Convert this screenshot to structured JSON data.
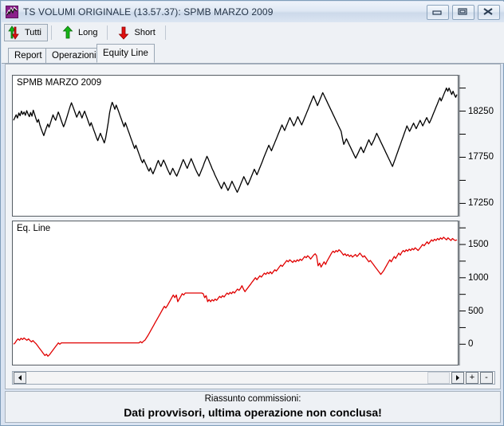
{
  "window": {
    "title": "TS VOLUMI ORIGINALE (13.57.37): SPMB MARZO 2009",
    "icon": "chart-line-icon",
    "controls": {
      "minimize": "minimize-icon",
      "maximize": "restore-icon",
      "close": "close-icon"
    }
  },
  "toolbar": {
    "buttons": [
      {
        "label": "Tutti",
        "icon": "up-down-arrows-icon",
        "active": true
      },
      {
        "label": "Long",
        "icon": "green-up-arrow-icon",
        "active": false
      },
      {
        "label": "Short",
        "icon": "red-down-arrow-icon",
        "active": false
      }
    ]
  },
  "tabs": {
    "items": [
      {
        "label": "Report",
        "selected": false
      },
      {
        "label": "Operazioni",
        "selected": false
      },
      {
        "label": "Equity Line",
        "selected": true
      }
    ]
  },
  "scrollbar": {
    "left_arrow": "left-arrow-icon",
    "right_arrow": "right-arrow-icon",
    "zoom_in": "+",
    "zoom_out": "-"
  },
  "status": {
    "line1": "Riassunto commissioni:",
    "line2": "Dati provvisori, ultima operazione non conclusa!"
  },
  "colors": {
    "price_line": "#000000",
    "equity_line": "#e00000",
    "chart_bg": "#ffffff",
    "chart_border": "#555c63",
    "window_bg": "#d9e3f1",
    "panel_bg": "#f2f4f7"
  },
  "chart_data": [
    {
      "type": "line",
      "title": "SPMB MARZO 2009",
      "name": "price-chart",
      "xlabel": "",
      "ylabel": "",
      "ylim": [
        17150,
        18600
      ],
      "yticks": [
        17250,
        17500,
        17750,
        18000,
        18250,
        18500
      ],
      "ytick_labels": [
        "17250",
        "",
        "17750",
        "",
        "18250",
        ""
      ],
      "grid": false,
      "legend": "none",
      "series": [
        {
          "name": "SPMB MARZO 2009",
          "color": "#000000",
          "values": [
            18150,
            18180,
            18210,
            18175,
            18230,
            18200,
            18250,
            18215,
            18240,
            18205,
            18255,
            18220,
            18190,
            18235,
            18195,
            18260,
            18215,
            18170,
            18130,
            18160,
            18100,
            18060,
            18020,
            17985,
            18030,
            18070,
            18110,
            18075,
            18120,
            18165,
            18210,
            18175,
            18150,
            18195,
            18240,
            18205,
            18160,
            18120,
            18080,
            18115,
            18160,
            18205,
            18255,
            18300,
            18340,
            18305,
            18265,
            18225,
            18185,
            18215,
            18250,
            18215,
            18175,
            18215,
            18250,
            18210,
            18170,
            18130,
            18090,
            18125,
            18085,
            18045,
            18005,
            17965,
            17930,
            17970,
            18010,
            17975,
            17940,
            17905,
            17960,
            18040,
            18130,
            18230,
            18300,
            18345,
            18310,
            18270,
            18315,
            18280,
            18240,
            18200,
            18160,
            18120,
            18080,
            18125,
            18085,
            18045,
            18005,
            17965,
            17925,
            17885,
            17845,
            17880,
            17840,
            17800,
            17760,
            17720,
            17690,
            17725,
            17690,
            17660,
            17625,
            17600,
            17635,
            17600,
            17570,
            17605,
            17640,
            17680,
            17715,
            17680,
            17650,
            17685,
            17720,
            17690,
            17655,
            17620,
            17590,
            17560,
            17595,
            17630,
            17600,
            17570,
            17545,
            17580,
            17615,
            17650,
            17690,
            17725,
            17695,
            17660,
            17630,
            17665,
            17700,
            17735,
            17700,
            17665,
            17630,
            17600,
            17570,
            17545,
            17580,
            17615,
            17650,
            17690,
            17725,
            17760,
            17730,
            17695,
            17660,
            17625,
            17595,
            17560,
            17530,
            17500,
            17470,
            17440,
            17410,
            17445,
            17480,
            17450,
            17420,
            17390,
            17420,
            17455,
            17490,
            17460,
            17430,
            17400,
            17370,
            17400,
            17435,
            17470,
            17505,
            17540,
            17510,
            17480,
            17450,
            17480,
            17515,
            17550,
            17585,
            17620,
            17590,
            17560,
            17595,
            17630,
            17665,
            17700,
            17740,
            17775,
            17810,
            17845,
            17880,
            17850,
            17820,
            17855,
            17890,
            17925,
            17960,
            17995,
            18030,
            18065,
            18100,
            18070,
            18040,
            18075,
            18110,
            18145,
            18180,
            18150,
            18120,
            18090,
            18120,
            18155,
            18190,
            18160,
            18130,
            18100,
            18135,
            18170,
            18205,
            18240,
            18275,
            18310,
            18345,
            18380,
            18415,
            18380,
            18345,
            18310,
            18345,
            18380,
            18415,
            18450,
            18420,
            18390,
            18360,
            18330,
            18300,
            18270,
            18240,
            18210,
            18180,
            18150,
            18120,
            18090,
            18060,
            18030,
            17950,
            17890,
            17920,
            17950,
            17920,
            17890,
            17860,
            17830,
            17800,
            17770,
            17740,
            17770,
            17800,
            17830,
            17860,
            17830,
            17800,
            17835,
            17870,
            17905,
            17940,
            17910,
            17880,
            17910,
            17940,
            17975,
            18010,
            17980,
            17950,
            17920,
            17890,
            17860,
            17830,
            17800,
            17770,
            17740,
            17710,
            17680,
            17650,
            17690,
            17730,
            17770,
            17810,
            17850,
            17890,
            17930,
            17970,
            18010,
            18050,
            18090,
            18060,
            18030,
            18060,
            18090,
            18120,
            18090,
            18060,
            18090,
            18120,
            18150,
            18120,
            18090,
            18120,
            18150,
            18180,
            18150,
            18120,
            18150,
            18185,
            18220,
            18255,
            18290,
            18325,
            18360,
            18395,
            18360,
            18395,
            18430,
            18465,
            18500,
            18465,
            18500,
            18465,
            18430,
            18465,
            18430,
            18400,
            18430
          ]
        }
      ]
    },
    {
      "type": "line",
      "title": "Eq. Line",
      "name": "equity-chart",
      "xlabel": "",
      "ylabel": "",
      "ylim": [
        -260,
        1800
      ],
      "yticks": [
        0,
        250,
        500,
        750,
        1000,
        1250,
        1500,
        1750
      ],
      "ytick_labels": [
        "0",
        "",
        "500",
        "",
        "1000",
        "",
        "1500",
        ""
      ],
      "grid": false,
      "legend": "none",
      "series": [
        {
          "name": "Eq. Line",
          "color": "#e00000",
          "values": [
            0,
            20,
            55,
            80,
            60,
            90,
            70,
            95,
            75,
            60,
            80,
            55,
            35,
            55,
            30,
            10,
            -20,
            -50,
            -80,
            -110,
            -140,
            -170,
            -150,
            -180,
            -160,
            -130,
            -100,
            -70,
            -40,
            -10,
            20,
            0,
            20,
            20,
            20,
            20,
            20,
            20,
            20,
            20,
            20,
            20,
            20,
            20,
            20,
            20,
            20,
            20,
            20,
            20,
            20,
            20,
            20,
            20,
            20,
            20,
            20,
            20,
            20,
            20,
            20,
            20,
            20,
            20,
            20,
            20,
            20,
            20,
            20,
            20,
            20,
            20,
            20,
            20,
            20,
            20,
            20,
            20,
            20,
            20,
            20,
            20,
            20,
            20,
            20,
            40,
            20,
            45,
            60,
            95,
            130,
            170,
            210,
            250,
            290,
            330,
            370,
            410,
            450,
            490,
            530,
            570,
            545,
            580,
            620,
            660,
            700,
            740,
            700,
            740,
            640,
            680,
            720,
            760,
            740,
            770,
            770,
            770,
            770,
            770,
            770,
            770,
            770,
            770,
            770,
            770,
            770,
            760,
            700,
            730,
            640,
            670,
            640,
            670,
            650,
            680,
            660,
            690,
            720,
            700,
            730,
            710,
            740,
            770,
            750,
            780,
            760,
            790,
            770,
            800,
            830,
            810,
            840,
            880,
            830,
            790,
            820,
            850,
            880,
            910,
            940,
            970,
            1000,
            970,
            1000,
            1030,
            1010,
            1040,
            1070,
            1050,
            1080,
            1060,
            1090,
            1060,
            1090,
            1120,
            1100,
            1130,
            1160,
            1190,
            1170,
            1200,
            1230,
            1260,
            1240,
            1270,
            1250,
            1230,
            1260,
            1240,
            1270,
            1250,
            1280,
            1260,
            1290,
            1320,
            1300,
            1330,
            1310,
            1280,
            1310,
            1340,
            1360,
            1330,
            1180,
            1220,
            1160,
            1200,
            1240,
            1200,
            1250,
            1290,
            1330,
            1370,
            1400,
            1380,
            1410,
            1390,
            1420,
            1400,
            1370,
            1340,
            1360,
            1330,
            1350,
            1320,
            1340,
            1310,
            1330,
            1350,
            1320,
            1340,
            1370,
            1340,
            1310,
            1330,
            1300,
            1270,
            1240,
            1260,
            1230,
            1200,
            1170,
            1140,
            1110,
            1080,
            1050,
            1080,
            1110,
            1150,
            1190,
            1230,
            1270,
            1240,
            1280,
            1320,
            1290,
            1330,
            1370,
            1340,
            1380,
            1410,
            1390,
            1420,
            1400,
            1430,
            1410,
            1440,
            1420,
            1450,
            1430,
            1410,
            1440,
            1470,
            1500,
            1480,
            1510,
            1540,
            1510,
            1540,
            1570,
            1550,
            1580,
            1560,
            1590,
            1570,
            1600,
            1580,
            1610,
            1590,
            1570,
            1600,
            1580,
            1560,
            1590,
            1570,
            1560,
            1570
          ]
        }
      ]
    }
  ]
}
